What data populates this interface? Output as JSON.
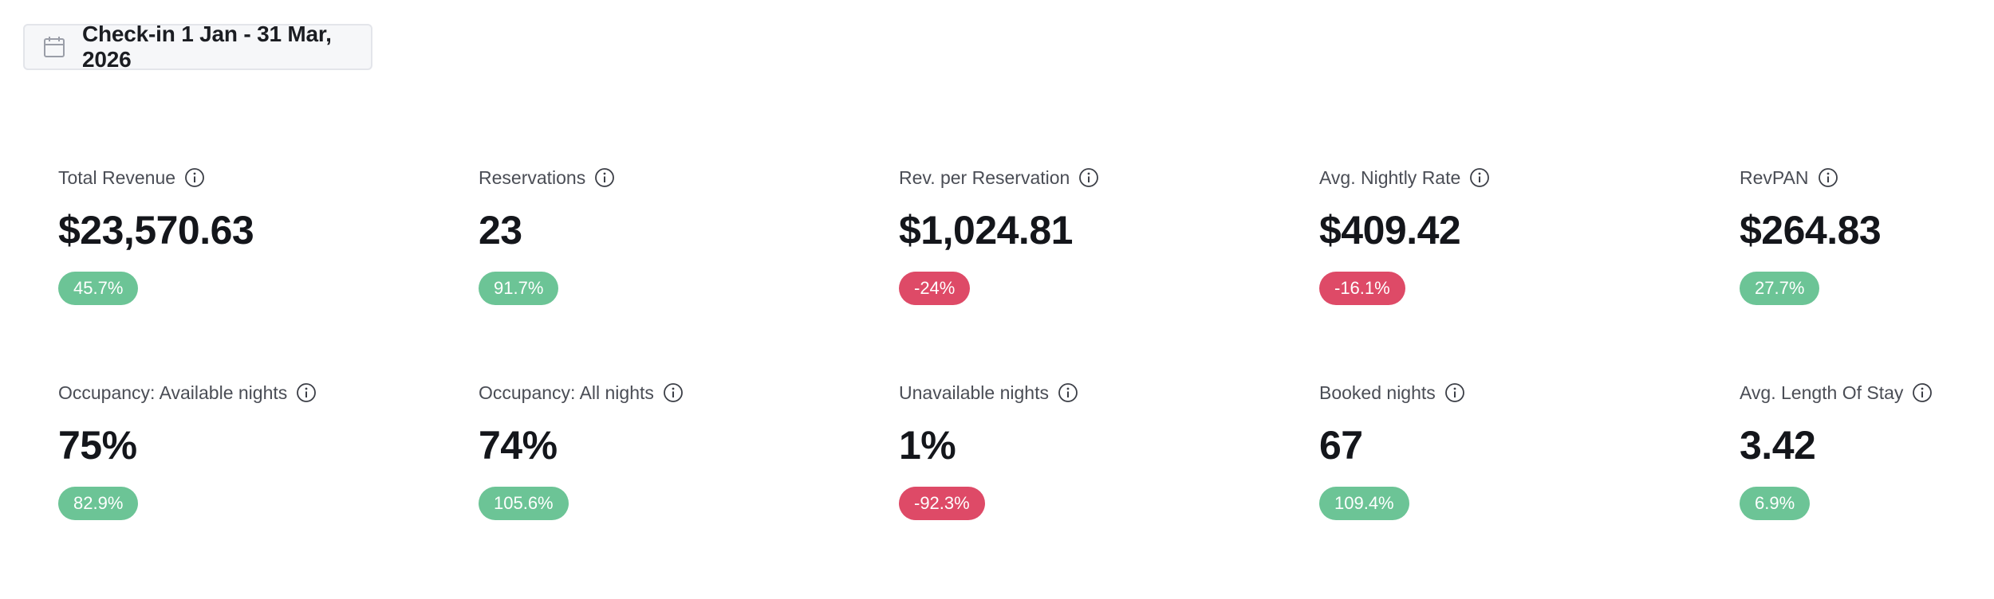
{
  "date_filter": {
    "label": "Check-in 1 Jan - 31 Mar, 2026",
    "icon": "calendar-icon"
  },
  "colors": {
    "positive": "#6cc496",
    "negative": "#de4a67",
    "text": "#14161b",
    "muted": "#4a4d55"
  },
  "metrics": [
    {
      "name": "total-revenue",
      "title": "Total Revenue",
      "value": "$23,570.63",
      "change": "45.7%",
      "trend": "up"
    },
    {
      "name": "reservations",
      "title": "Reservations",
      "value": "23",
      "change": "91.7%",
      "trend": "up"
    },
    {
      "name": "rev-per-reservation",
      "title": "Rev. per Reservation",
      "value": "$1,024.81",
      "change": "-24%",
      "trend": "down"
    },
    {
      "name": "avg-nightly-rate",
      "title": "Avg. Nightly Rate",
      "value": "$409.42",
      "change": "-16.1%",
      "trend": "down"
    },
    {
      "name": "revpan",
      "title": "RevPAN",
      "value": "$264.83",
      "change": "27.7%",
      "trend": "up"
    },
    {
      "name": "occupancy-available-nights",
      "title": "Occupancy: Available nights",
      "value": "75%",
      "change": "82.9%",
      "trend": "up"
    },
    {
      "name": "occupancy-all-nights",
      "title": "Occupancy: All nights",
      "value": "74%",
      "change": "105.6%",
      "trend": "up"
    },
    {
      "name": "unavailable-nights",
      "title": "Unavailable nights",
      "value": "1%",
      "change": "-92.3%",
      "trend": "down"
    },
    {
      "name": "booked-nights",
      "title": "Booked nights",
      "value": "67",
      "change": "109.4%",
      "trend": "up"
    },
    {
      "name": "avg-length-of-stay",
      "title": "Avg. Length Of Stay",
      "value": "3.42",
      "change": "6.9%",
      "trend": "up"
    }
  ]
}
